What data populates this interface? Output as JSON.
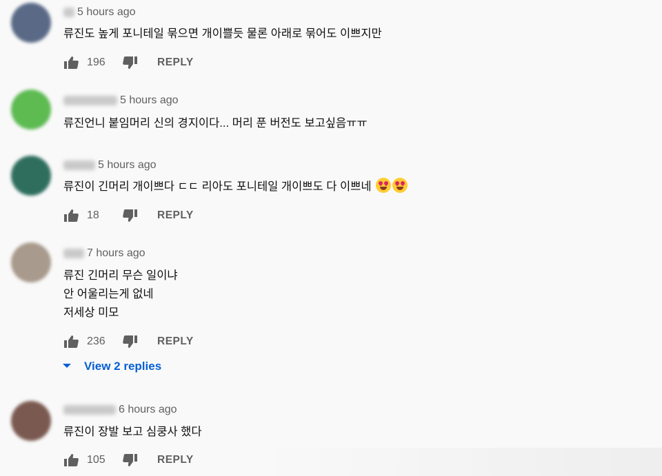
{
  "comments": [
    {
      "avatar_color": "#5a6a86",
      "timestamp": "5 hours ago",
      "lines": [
        "류진도 높게 포니테일 묶으면 개이쁠듯 물론 아래로 묶어도 이쁘지만"
      ],
      "likes": "196",
      "reply_label": "REPLY"
    },
    {
      "avatar_color": "#5dbb52",
      "timestamp": "5 hours ago",
      "lines": [
        "류진언니 붙임머리 신의 경지이다... 머리 푼 버전도 보고싶음ㅠㅠ"
      ]
    },
    {
      "avatar_color": "#2f6e5d",
      "timestamp": "5 hours ago",
      "lines": [
        "류진이 긴머리 개이쁘다 ㄷㄷ 리아도 포니테일 개이쁘도 다 이쁘네"
      ],
      "emojis": [
        "heart-eyes-emoji",
        "heart-eyes-emoji"
      ],
      "likes": "18",
      "reply_label": "REPLY"
    },
    {
      "avatar_color": "#a89a8c",
      "timestamp": "7 hours ago",
      "lines": [
        "류진 긴머리 무슨 일이냐",
        "안 어울리는게 없네",
        "저세상 미모"
      ],
      "likes": "236",
      "reply_label": "REPLY"
    },
    {
      "avatar_color": "#7a5a50",
      "timestamp": "6 hours ago",
      "lines": [
        "류진이 장발 보고 심쿵사 했다"
      ],
      "likes": "105",
      "reply_label": "REPLY"
    }
  ],
  "view_replies": "View 2 replies",
  "colors": {
    "link_blue": "#065fd4",
    "meta_gray": "#606060"
  },
  "icons": [
    "thumbs-up-icon",
    "thumbs-down-icon",
    "caret-down-icon"
  ]
}
